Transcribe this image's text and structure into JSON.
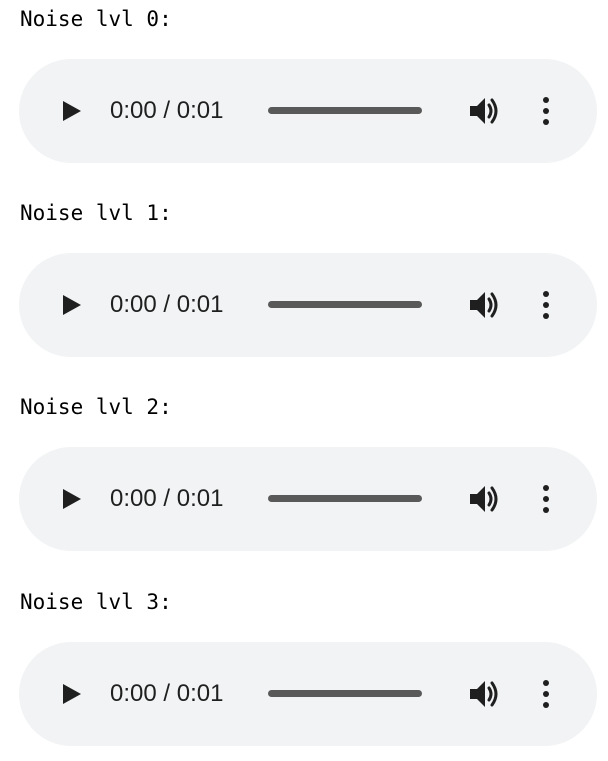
{
  "players": [
    {
      "label": "Noise lvl 0:",
      "time": "0:00 / 0:01",
      "progress": 0
    },
    {
      "label": "Noise lvl 1:",
      "time": "0:00 / 0:01",
      "progress": 0
    },
    {
      "label": "Noise lvl 2:",
      "time": "0:00 / 0:01",
      "progress": 0
    },
    {
      "label": "Noise lvl 3:",
      "time": "0:00 / 0:01",
      "progress": 0
    }
  ],
  "icons": {
    "play": "play-icon",
    "volume": "volume-icon",
    "more": "more-options-icon"
  },
  "colors": {
    "player_background": "#f1f3f4",
    "track": "#595959",
    "icon": "#1f1f1f"
  }
}
